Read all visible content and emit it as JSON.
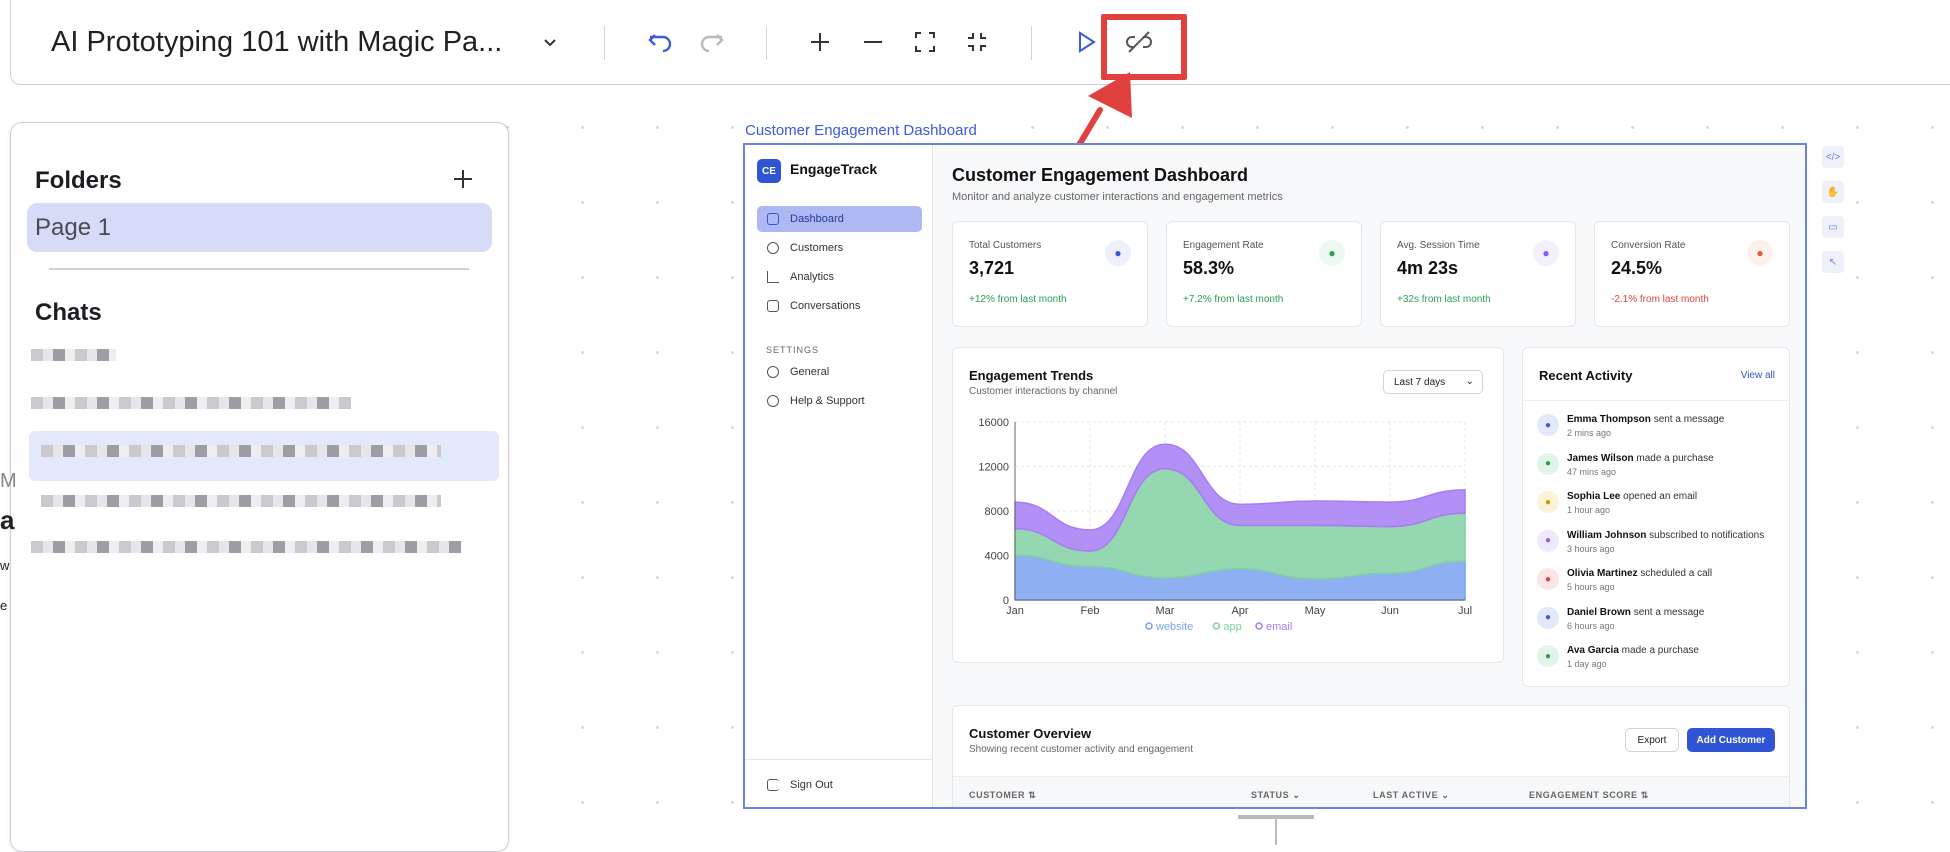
{
  "toolbar": {
    "title": "AI Prototyping 101 with Magic Pa...",
    "icons": [
      "chevron-down-icon",
      "undo-icon",
      "redo-icon",
      "plus-icon",
      "minus-icon",
      "fit-icon",
      "collapse-icon",
      "play-icon",
      "link-off-icon"
    ]
  },
  "panel": {
    "folders_title": "Folders",
    "page1": "Page 1",
    "chats_title": "Chats"
  },
  "edge": {
    "a": "a",
    "m": "M",
    "w": "w",
    "e": "e"
  },
  "frame": {
    "label": "Customer Engagement Dashboard"
  },
  "app": {
    "logo": "CE",
    "brand": "EngageTrack",
    "nav": [
      {
        "label": "Dashboard"
      },
      {
        "label": "Customers"
      },
      {
        "label": "Analytics"
      },
      {
        "label": "Conversations"
      }
    ],
    "settings_label": "SETTINGS",
    "settings_nav": [
      {
        "label": "General"
      },
      {
        "label": "Help & Support"
      }
    ],
    "signout": "Sign Out",
    "title": "Customer Engagement Dashboard",
    "subtitle": "Monitor and analyze customer interactions and engagement metrics",
    "stats": [
      {
        "label": "Total Customers",
        "value": "3,721",
        "change": "+12% from last month",
        "icon": "users-icon",
        "color": "#3b5bd9",
        "bg": "#eef1fb"
      },
      {
        "label": "Engagement Rate",
        "value": "58.3%",
        "change": "+7.2% from last month",
        "icon": "activity-icon",
        "color": "#2aa14f",
        "bg": "#ecf8f0"
      },
      {
        "label": "Avg. Session Time",
        "value": "4m 23s",
        "change": "+32s from last month",
        "icon": "clock-icon",
        "color": "#8b5cf6",
        "bg": "#f3effd"
      },
      {
        "label": "Conversion Rate",
        "value": "24.5%",
        "change": "-2.1% from last month",
        "icon": "trending-up-icon",
        "color": "#e55a2b",
        "bg": "#fdf1ec"
      }
    ],
    "trends": {
      "title": "Engagement Trends",
      "subtitle": "Customer interactions by channel",
      "range": "Last 7 days"
    },
    "activity": {
      "title": "Recent Activity",
      "view_all": "View all",
      "items": [
        {
          "name": "Emma Thompson",
          "action": "sent a message",
          "time": "2 mins ago",
          "color": "#3b5bd9",
          "bg": "#e3e9fb"
        },
        {
          "name": "James Wilson",
          "action": "made a purchase",
          "time": "47 mins ago",
          "color": "#2aa14f",
          "bg": "#e2f5e8"
        },
        {
          "name": "Sophia Lee",
          "action": "opened an email",
          "time": "1 hour ago",
          "color": "#c99a06",
          "bg": "#fcf3d6"
        },
        {
          "name": "William Johnson",
          "action": "subscribed to notifications",
          "time": "3 hours ago",
          "color": "#8b5cf6",
          "bg": "#efe9fd"
        },
        {
          "name": "Olivia Martinez",
          "action": "scheduled a call",
          "time": "5 hours ago",
          "color": "#e0413f",
          "bg": "#fce6e5"
        },
        {
          "name": "Daniel Brown",
          "action": "sent a message",
          "time": "6 hours ago",
          "color": "#3b5bd9",
          "bg": "#e3e9fb"
        },
        {
          "name": "Ava Garcia",
          "action": "made a purchase",
          "time": "1 day ago",
          "color": "#2aa14f",
          "bg": "#e2f5e8"
        }
      ]
    },
    "overview": {
      "title": "Customer Overview",
      "subtitle": "Showing recent customer activity and engagement",
      "export": "Export",
      "add": "Add Customer",
      "columns": [
        "CUSTOMER ⇅",
        "STATUS ⌄",
        "LAST ACTIVE ⌄",
        "ENGAGEMENT SCORE ⇅"
      ]
    }
  },
  "chart_data": {
    "type": "area",
    "x": [
      "Jan",
      "Feb",
      "Mar",
      "Apr",
      "May",
      "Jun",
      "Jul"
    ],
    "ylim": [
      0,
      16000
    ],
    "yticks": [
      0,
      4000,
      8000,
      12000,
      16000
    ],
    "series": [
      {
        "name": "website",
        "values": [
          4000,
          3000,
          2000,
          2800,
          1900,
          2400,
          3500
        ],
        "color": "#7aa2f0"
      },
      {
        "name": "app",
        "values": [
          2400,
          1400,
          9800,
          3900,
          4800,
          4200,
          4300
        ],
        "color": "#82d0a3"
      },
      {
        "name": "email",
        "values": [
          2400,
          1900,
          2200,
          1900,
          2200,
          2200,
          2100
        ],
        "color": "#a67df5"
      }
    ]
  }
}
